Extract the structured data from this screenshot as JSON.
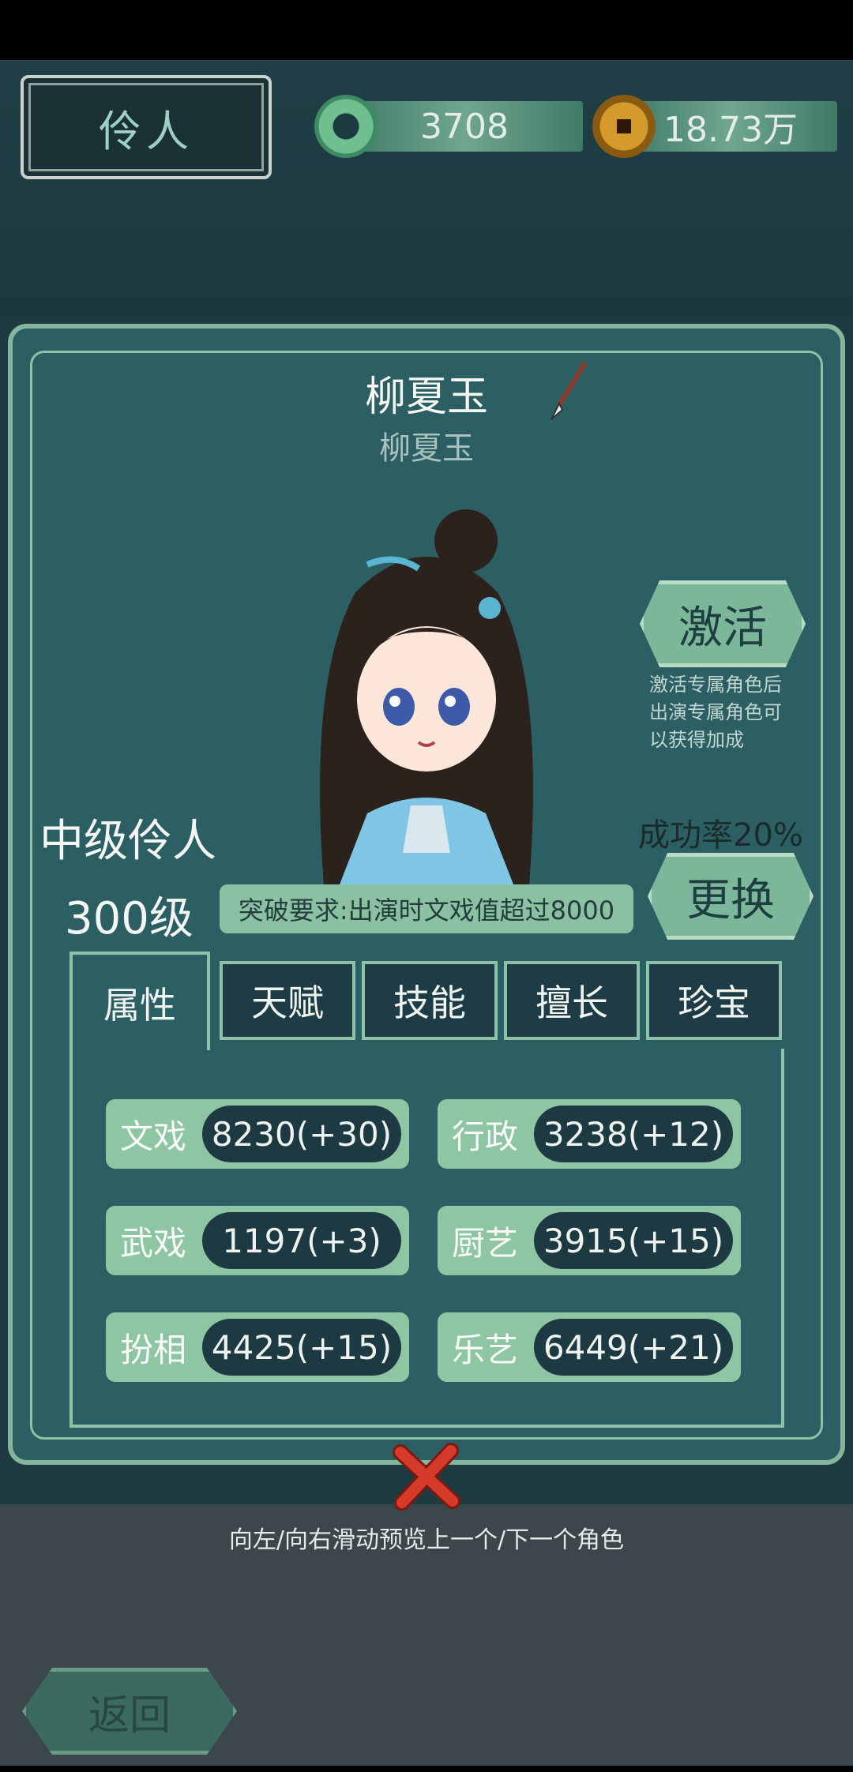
{
  "header": {
    "title": "伶人"
  },
  "currency": {
    "jade": "3708",
    "coins": "18.73万"
  },
  "character": {
    "name": "柳夏玉",
    "subtitle": "柳夏玉",
    "rank": "中级伶人",
    "level": "300级"
  },
  "activate": {
    "label": "激活",
    "note_lines": [
      "激活专属角色后",
      "出演专属角色可",
      "以获得加成"
    ]
  },
  "success_rate": "成功率20%",
  "swap_label": "更换",
  "breakthrough": "突破要求:出演时文戏值超过8000",
  "tabs": [
    "属性",
    "天赋",
    "技能",
    "擅长",
    "珍宝"
  ],
  "stats": [
    {
      "label": "文戏",
      "value": "8230(+30)"
    },
    {
      "label": "行政",
      "value": "3238(+12)"
    },
    {
      "label": "武戏",
      "value": "1197(+3)"
    },
    {
      "label": "厨艺",
      "value": "3915(+15)"
    },
    {
      "label": "扮相",
      "value": "4425(+15)"
    },
    {
      "label": "乐艺",
      "value": "6449(+21)"
    }
  ],
  "swipe_hint": "向左/向右滑动预览上一个/下一个角色",
  "back_label": "返回",
  "colors": {
    "accent": "#86b59d",
    "panel": "#2c5f63",
    "close": "#d63a2a"
  }
}
